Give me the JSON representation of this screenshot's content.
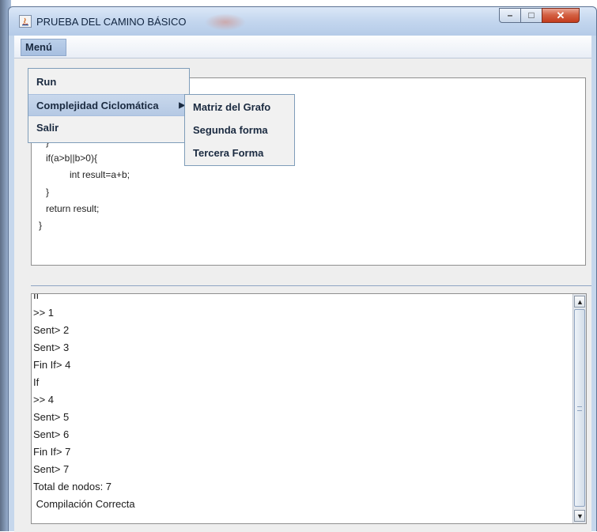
{
  "window": {
    "title": "PRUEBA DEL CAMINO BÁSICO",
    "controls": {
      "minimize": "–",
      "maximize": "□",
      "close": "✕"
    }
  },
  "menubar": {
    "menu_label": "Menú"
  },
  "menu_popup": {
    "items": [
      {
        "label": "Run"
      },
      {
        "label": "Complejidad Ciclomática",
        "has_submenu": true
      },
      {
        "label": "Salir"
      }
    ]
  },
  "submenu": {
    "items": [
      {
        "label": "Matriz del Grafo"
      },
      {
        "label": "Segunda forma"
      },
      {
        "label": "Tercera Forma"
      }
    ]
  },
  "code_editor": {
    "lines": [
      "}",
      "if(a>b||b>0){",
      "int result=a+b;",
      "}",
      "return result;",
      "}"
    ]
  },
  "output": {
    "lines": [
      "If",
      ">> 1",
      "Sent> 2",
      "Sent> 3",
      "Fin If> 4",
      "If",
      ">> 4",
      "Sent> 5",
      "Sent> 6",
      "Fin If> 7",
      "Sent> 7",
      "Total de nodos: 7",
      " Compilación Correcta"
    ]
  },
  "colors": {
    "titlebar": "#c3d6ee",
    "close_button": "#c43c1d",
    "menu_highlight": "#b5c9e4",
    "panel_border": "#8f8f8f"
  },
  "icons": {
    "app": "java-app-icon",
    "submenu": "submenu-arrow-icon",
    "scroll_up": "scroll-up-arrow-icon",
    "scroll_down": "scroll-down-arrow-icon"
  }
}
